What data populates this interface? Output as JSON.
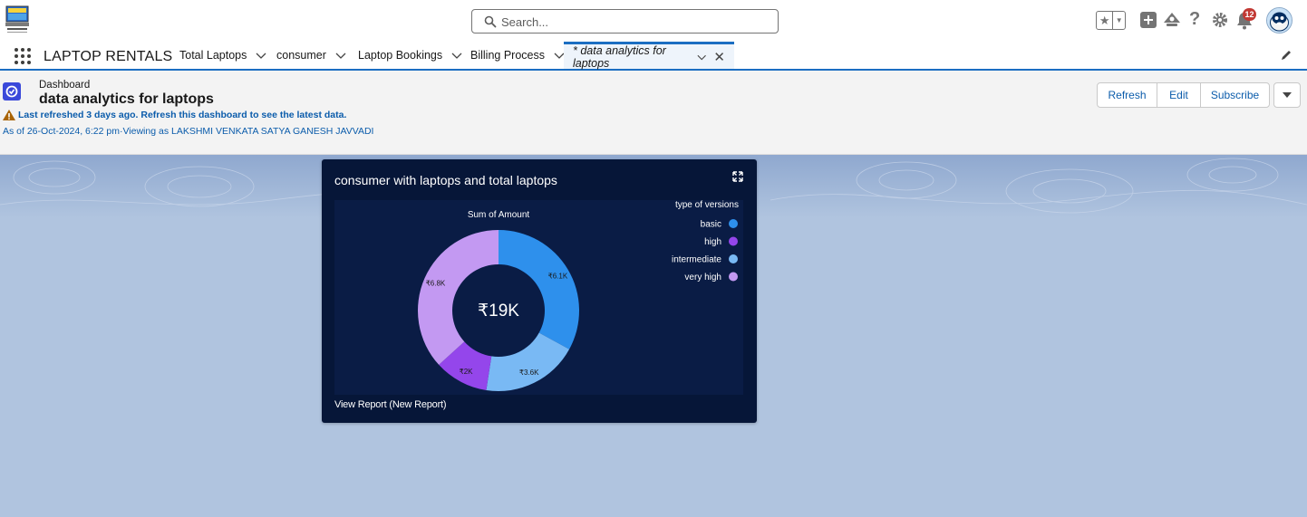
{
  "header": {
    "search_placeholder": "Search...",
    "notification_count": "12",
    "favorites_icon": "star-icon",
    "icons": [
      "add-icon",
      "trailhead-icon",
      "help-icon",
      "gear-icon",
      "bell-icon"
    ]
  },
  "nav": {
    "app_name": "LAPTOP RENTALS",
    "tabs": [
      {
        "label": "Total Laptops"
      },
      {
        "label": "consumer"
      },
      {
        "label": "Laptop Bookings"
      },
      {
        "label": "Billing Process"
      },
      {
        "label": "* data analytics for laptops",
        "active": true
      }
    ]
  },
  "dashboard": {
    "type_label": "Dashboard",
    "title": "data analytics for laptops",
    "warning": "Last refreshed 3 days ago. Refresh this dashboard to see the latest data.",
    "as_of": "As of 26-Oct-2024, 6:22 pm·Viewing as LAKSHMI VENKATA SATYA GANESH JAVVADI",
    "buttons": {
      "refresh": "Refresh",
      "edit": "Edit",
      "subscribe": "Subscribe"
    }
  },
  "widget": {
    "title": "consumer with laptops and total laptops",
    "footer_link": "View Report (New Report)"
  },
  "chart_data": {
    "type": "pie",
    "donut": true,
    "title": "Sum of Amount",
    "center_label": "₹19K",
    "legend_title": "type of versions",
    "legend_position": "top-right",
    "slices": [
      {
        "name": "basic",
        "value": 6.1,
        "label": "₹6.1K",
        "color": "#2e90ec"
      },
      {
        "name": "intermediate",
        "value": 3.6,
        "label": "₹3.6K",
        "color": "#79b9f4"
      },
      {
        "name": "high",
        "value": 2.0,
        "label": "₹2K",
        "color": "#9446eb"
      },
      {
        "name": "very high",
        "value": 6.8,
        "label": "₹6.8K",
        "color": "#c399f2"
      }
    ],
    "legend_order": [
      "basic",
      "high",
      "intermediate",
      "very high"
    ],
    "unit": "K"
  }
}
